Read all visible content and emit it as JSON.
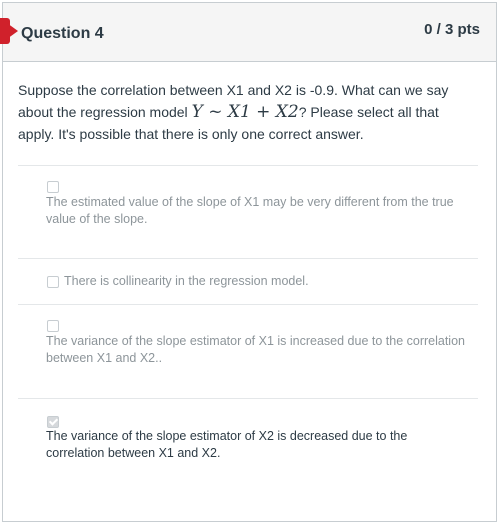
{
  "question": {
    "title": "Question 4",
    "points": "0 / 3 pts",
    "text_before": "Suppose the correlation between X1 and X2 is -0.9. What can we say about the regression model ",
    "formula": "Y ~ X1 + X2",
    "text_after": "? Please select all that apply. It's possible that there is only one correct answer."
  },
  "answers": [
    {
      "label": "The estimated value of the slope of X1 may be very different from the true value of the slope.",
      "checked": false
    },
    {
      "label": "There is collinearity in the regression model.",
      "checked": false
    },
    {
      "label": "The variance of the slope estimator of X1 is increased due to the correlation between X1 and X2..",
      "checked": false
    },
    {
      "label": "The variance of the slope estimator of X2 is decreased due to the correlation between X1 and X2.",
      "checked": true
    }
  ],
  "colors": {
    "flag": "#d0212b",
    "header_bg": "#f5f5f5",
    "text": "#2d3b45",
    "dim_text": "#8d959a"
  }
}
